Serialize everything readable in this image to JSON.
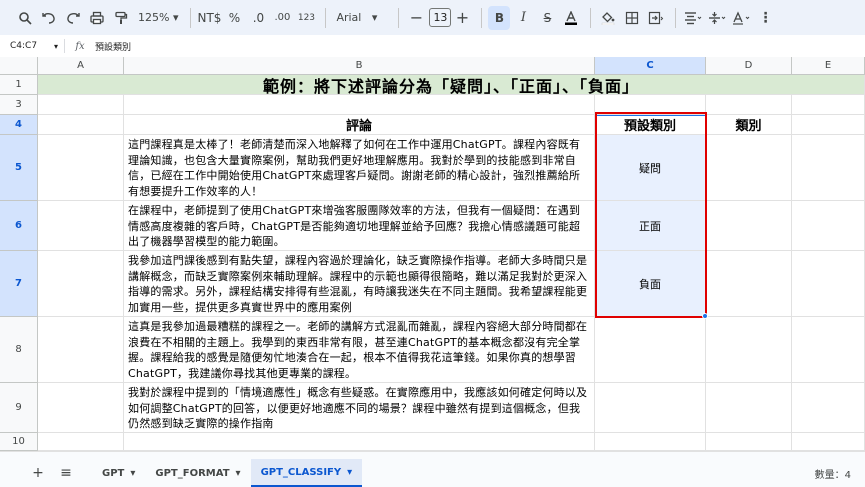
{
  "toolbar": {
    "zoom": "125%",
    "currency": "NT$",
    "percent": "%",
    "dec_minus": ".0",
    "dec_plus": ".00",
    "number_format": "123",
    "font": "Arial",
    "font_size": "13",
    "bold": "B"
  },
  "formula_bar": {
    "name_box": "C4:C7",
    "fx": "fx",
    "content": "預設類別"
  },
  "columns": [
    "A",
    "B",
    "C",
    "D",
    "E"
  ],
  "rows": [
    "1",
    "3",
    "4",
    "5",
    "6",
    "7",
    "8",
    "9",
    "10"
  ],
  "cells": {
    "title": "範例：將下述評論分為「疑問」、「正面」、「負面」",
    "header_review": "評論",
    "header_default": "預設類別",
    "header_category": "類別",
    "reviews": [
      "這門課程真是太棒了！老師清楚而深入地解釋了如何在工作中運用ChatGPT。課程內容既有理論知識，也包含大量實際案例，幫助我們更好地理解應用。我對於學到的技能感到非常自信，已經在工作中開始使用ChatGPT來處理客戶疑問。謝謝老師的精心設計，強烈推薦給所有想要提升工作效率的人！",
      "在課程中，老師提到了使用ChatGPT來增強客服團隊效率的方法，但我有一個疑問：在遇到情感高度複雜的客戶時，ChatGPT是否能夠適切地理解並給予回應？我擔心情感議題可能超出了機器學習模型的能力範圍。",
      "我參加這門課後感到有點失望，課程內容過於理論化，缺乏實際操作指導。老師大多時間只是講解概念，而缺乏實際案例來輔助理解。課程中的示範也顯得很簡略，難以滿足我對於更深入指導的需求。另外，課程結構安排得有些混亂，有時讓我迷失在不同主題間。我希望課程能更加實用一些，提供更多真實世界中的應用案例",
      "這真是我參加過最糟糕的課程之一。老師的講解方式混亂而雜亂，課程內容絕大部分時間都在浪費在不相關的主題上。我學到的東西非常有限，甚至連ChatGPT的基本概念都沒有完全掌握。課程給我的感覺是隨便匆忙地湊合在一起，根本不值得我花這筆錢。如果你真的想學習ChatGPT，我建議你尋找其他更專業的課程。",
      "我對於課程中提到的「情境適應性」概念有些疑惑。在實際應用中，我應該如何確定何時以及如何調整ChatGPT的回答，以便更好地適應不同的場景？課程中雖然有提到這個概念，但我仍然感到缺乏實際的操作指南"
    ],
    "default_categories": [
      "疑問",
      "正面",
      "負面"
    ]
  },
  "tabs": {
    "add": "+",
    "list": "≡",
    "sheets": [
      "GPT",
      "GPT_FORMAT",
      "GPT_CLASSIFY"
    ],
    "active": "GPT_CLASSIFY",
    "count": "數量：4"
  },
  "colors": {
    "title_bg": "#d9ead3",
    "selection": "#e8f0fe",
    "highlight_border": "#e00000",
    "accent": "#0b57d0"
  }
}
